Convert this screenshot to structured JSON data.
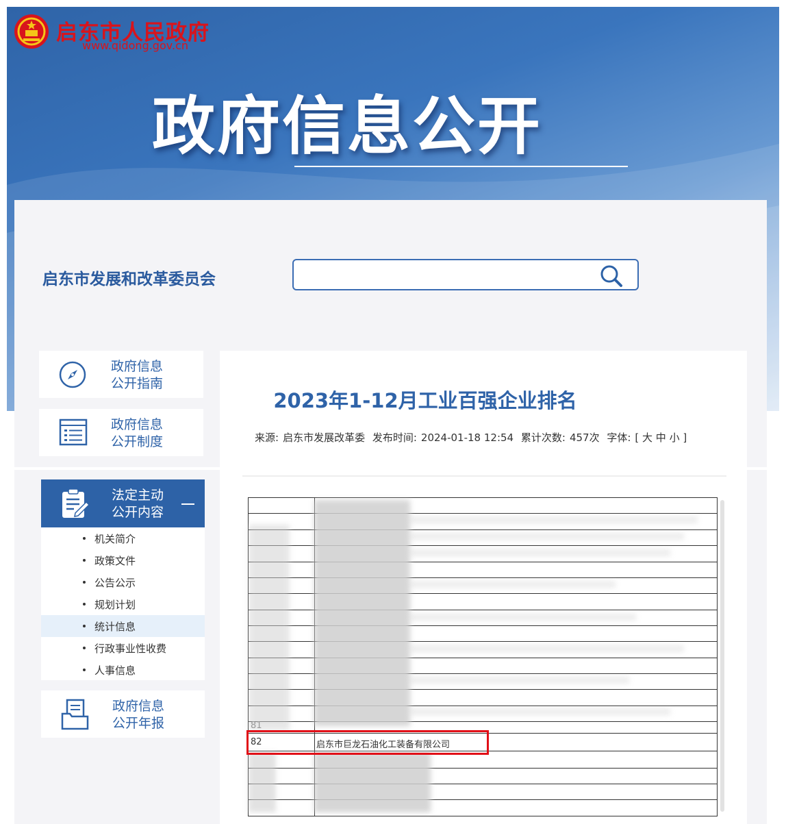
{
  "header": {
    "site_name": "启东市人民政府",
    "site_url": "www.qidong.gov.cn",
    "banner_title": "政府信息公开"
  },
  "department": "启东市发展和改革委员会",
  "search": {
    "placeholder": "",
    "value": ""
  },
  "sidebar": {
    "cards": [
      {
        "line1": "政府信息",
        "line2": "公开指南",
        "icon": "compass-icon"
      },
      {
        "line1": "政府信息",
        "line2": "公开制度",
        "icon": "list-icon"
      }
    ],
    "active_section": {
      "line1": "法定主动",
      "line2": "公开内容",
      "icon": "clipboard-edit-icon"
    },
    "menu_items": [
      {
        "label": "机关简介",
        "active": false
      },
      {
        "label": "政策文件",
        "active": false
      },
      {
        "label": "公告公示",
        "active": false
      },
      {
        "label": "规划计划",
        "active": false
      },
      {
        "label": "统计信息",
        "active": true
      },
      {
        "label": "行政事业性收费",
        "active": false
      },
      {
        "label": "人事信息",
        "active": false
      }
    ],
    "report_card": {
      "line1": "政府信息",
      "line2": "公开年报",
      "icon": "folder-document-icon"
    }
  },
  "article": {
    "title": "2023年1-12月工业百强企业排名",
    "meta": {
      "source_label": "来源:",
      "source": "启东市发展改革委",
      "publish_label": "发布时间:",
      "publish_time": "2024-01-18 12:54",
      "count_label": "累计次数:",
      "count": "457次",
      "font_label": "字体:",
      "font_options": "[ 大 中 小 ]"
    },
    "table": {
      "visible_numbers": [
        "81",
        "82"
      ],
      "highlighted_row": {
        "rank": "82",
        "company": "启东市巨龙石油化工装备有限公司"
      }
    }
  }
}
